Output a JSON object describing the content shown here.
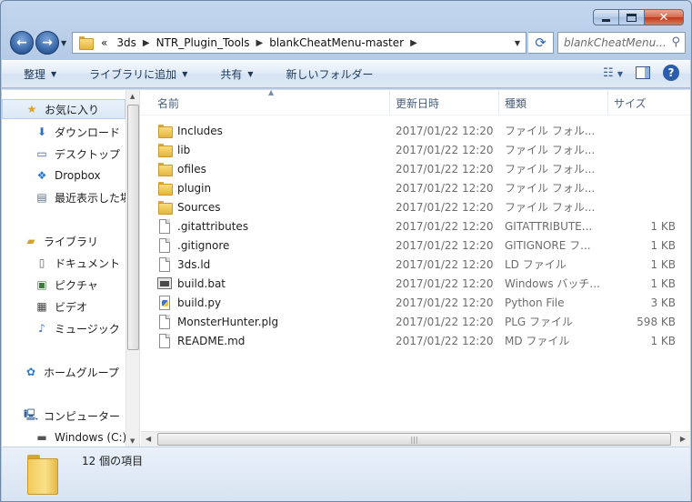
{
  "address": {
    "overflow": "«",
    "crumbs": [
      "3ds",
      "NTR_Plugin_Tools",
      "blankCheatMenu-master"
    ]
  },
  "search": {
    "placeholder": "blankCheatMenu..."
  },
  "toolbar": {
    "organize": "整理",
    "include_library": "ライブラリに追加",
    "share": "共有",
    "new_folder": "新しいフォルダー"
  },
  "nav_pane": {
    "favorites": "お気に入り",
    "downloads": "ダウンロード",
    "desktop": "デスクトップ",
    "dropbox": "Dropbox",
    "recent": "最近表示した場所",
    "libraries": "ライブラリ",
    "documents": "ドキュメント",
    "pictures": "ピクチャ",
    "videos": "ビデオ",
    "music": "ミュージック",
    "homegroup": "ホームグループ",
    "computer": "コンピューター",
    "windows_drive": "Windows (C:)"
  },
  "columns": {
    "name": "名前",
    "date": "更新日時",
    "type": "種類",
    "size": "サイズ"
  },
  "files": [
    {
      "name": "Includes",
      "date": "2017/01/22 12:20",
      "type": "ファイル フォル...",
      "size": "",
      "icon": "folder-icon"
    },
    {
      "name": "lib",
      "date": "2017/01/22 12:20",
      "type": "ファイル フォル...",
      "size": "",
      "icon": "folder-icon"
    },
    {
      "name": "ofiles",
      "date": "2017/01/22 12:20",
      "type": "ファイル フォル...",
      "size": "",
      "icon": "folder-icon"
    },
    {
      "name": "plugin",
      "date": "2017/01/22 12:20",
      "type": "ファイル フォル...",
      "size": "",
      "icon": "folder-icon"
    },
    {
      "name": "Sources",
      "date": "2017/01/22 12:20",
      "type": "ファイル フォル...",
      "size": "",
      "icon": "folder-icon"
    },
    {
      "name": ".gitattributes",
      "date": "2017/01/22 12:20",
      "type": "GITATTRIBUTE...",
      "size": "1 KB",
      "icon": "document-icon"
    },
    {
      "name": ".gitignore",
      "date": "2017/01/22 12:20",
      "type": "GITIGNORE フ...",
      "size": "1 KB",
      "icon": "document-icon"
    },
    {
      "name": "3ds.ld",
      "date": "2017/01/22 12:20",
      "type": "LD ファイル",
      "size": "1 KB",
      "icon": "document-icon"
    },
    {
      "name": "build.bat",
      "date": "2017/01/22 12:20",
      "type": "Windows バッチ...",
      "size": "1 KB",
      "icon": "batch-file-icon"
    },
    {
      "name": "build.py",
      "date": "2017/01/22 12:20",
      "type": "Python File",
      "size": "3 KB",
      "icon": "python-file-icon"
    },
    {
      "name": "MonsterHunter.plg",
      "date": "2017/01/22 12:20",
      "type": "PLG ファイル",
      "size": "598 KB",
      "icon": "document-icon"
    },
    {
      "name": "README.md",
      "date": "2017/01/22 12:20",
      "type": "MD ファイル",
      "size": "1 KB",
      "icon": "document-icon"
    }
  ],
  "status": {
    "item_count": "12 個の項目"
  },
  "colors": {
    "window_frame": "#b9cde7",
    "toolbar": "#dfe9f5",
    "accent": "#2a5db0"
  }
}
